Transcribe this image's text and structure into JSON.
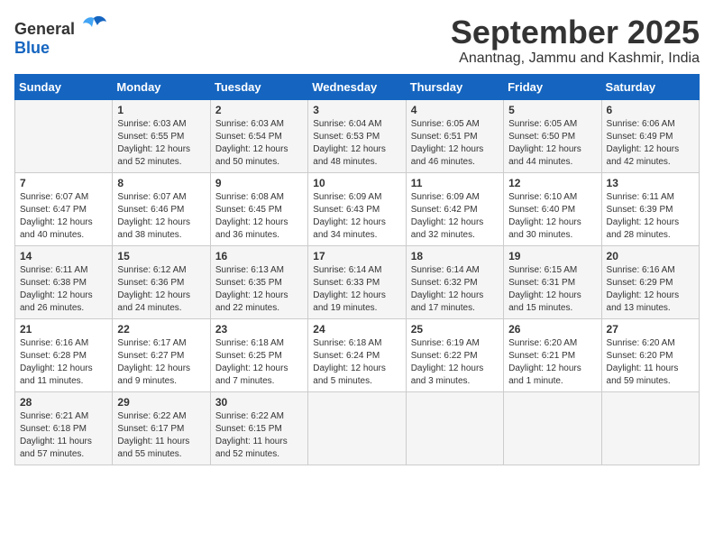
{
  "logo": {
    "general": "General",
    "blue": "Blue"
  },
  "header": {
    "month": "September 2025",
    "location": "Anantnag, Jammu and Kashmir, India"
  },
  "weekdays": [
    "Sunday",
    "Monday",
    "Tuesday",
    "Wednesday",
    "Thursday",
    "Friday",
    "Saturday"
  ],
  "weeks": [
    [
      {
        "day": "",
        "content": ""
      },
      {
        "day": "1",
        "content": "Sunrise: 6:03 AM\nSunset: 6:55 PM\nDaylight: 12 hours\nand 52 minutes."
      },
      {
        "day": "2",
        "content": "Sunrise: 6:03 AM\nSunset: 6:54 PM\nDaylight: 12 hours\nand 50 minutes."
      },
      {
        "day": "3",
        "content": "Sunrise: 6:04 AM\nSunset: 6:53 PM\nDaylight: 12 hours\nand 48 minutes."
      },
      {
        "day": "4",
        "content": "Sunrise: 6:05 AM\nSunset: 6:51 PM\nDaylight: 12 hours\nand 46 minutes."
      },
      {
        "day": "5",
        "content": "Sunrise: 6:05 AM\nSunset: 6:50 PM\nDaylight: 12 hours\nand 44 minutes."
      },
      {
        "day": "6",
        "content": "Sunrise: 6:06 AM\nSunset: 6:49 PM\nDaylight: 12 hours\nand 42 minutes."
      }
    ],
    [
      {
        "day": "7",
        "content": "Sunrise: 6:07 AM\nSunset: 6:47 PM\nDaylight: 12 hours\nand 40 minutes."
      },
      {
        "day": "8",
        "content": "Sunrise: 6:07 AM\nSunset: 6:46 PM\nDaylight: 12 hours\nand 38 minutes."
      },
      {
        "day": "9",
        "content": "Sunrise: 6:08 AM\nSunset: 6:45 PM\nDaylight: 12 hours\nand 36 minutes."
      },
      {
        "day": "10",
        "content": "Sunrise: 6:09 AM\nSunset: 6:43 PM\nDaylight: 12 hours\nand 34 minutes."
      },
      {
        "day": "11",
        "content": "Sunrise: 6:09 AM\nSunset: 6:42 PM\nDaylight: 12 hours\nand 32 minutes."
      },
      {
        "day": "12",
        "content": "Sunrise: 6:10 AM\nSunset: 6:40 PM\nDaylight: 12 hours\nand 30 minutes."
      },
      {
        "day": "13",
        "content": "Sunrise: 6:11 AM\nSunset: 6:39 PM\nDaylight: 12 hours\nand 28 minutes."
      }
    ],
    [
      {
        "day": "14",
        "content": "Sunrise: 6:11 AM\nSunset: 6:38 PM\nDaylight: 12 hours\nand 26 minutes."
      },
      {
        "day": "15",
        "content": "Sunrise: 6:12 AM\nSunset: 6:36 PM\nDaylight: 12 hours\nand 24 minutes."
      },
      {
        "day": "16",
        "content": "Sunrise: 6:13 AM\nSunset: 6:35 PM\nDaylight: 12 hours\nand 22 minutes."
      },
      {
        "day": "17",
        "content": "Sunrise: 6:14 AM\nSunset: 6:33 PM\nDaylight: 12 hours\nand 19 minutes."
      },
      {
        "day": "18",
        "content": "Sunrise: 6:14 AM\nSunset: 6:32 PM\nDaylight: 12 hours\nand 17 minutes."
      },
      {
        "day": "19",
        "content": "Sunrise: 6:15 AM\nSunset: 6:31 PM\nDaylight: 12 hours\nand 15 minutes."
      },
      {
        "day": "20",
        "content": "Sunrise: 6:16 AM\nSunset: 6:29 PM\nDaylight: 12 hours\nand 13 minutes."
      }
    ],
    [
      {
        "day": "21",
        "content": "Sunrise: 6:16 AM\nSunset: 6:28 PM\nDaylight: 12 hours\nand 11 minutes."
      },
      {
        "day": "22",
        "content": "Sunrise: 6:17 AM\nSunset: 6:27 PM\nDaylight: 12 hours\nand 9 minutes."
      },
      {
        "day": "23",
        "content": "Sunrise: 6:18 AM\nSunset: 6:25 PM\nDaylight: 12 hours\nand 7 minutes."
      },
      {
        "day": "24",
        "content": "Sunrise: 6:18 AM\nSunset: 6:24 PM\nDaylight: 12 hours\nand 5 minutes."
      },
      {
        "day": "25",
        "content": "Sunrise: 6:19 AM\nSunset: 6:22 PM\nDaylight: 12 hours\nand 3 minutes."
      },
      {
        "day": "26",
        "content": "Sunrise: 6:20 AM\nSunset: 6:21 PM\nDaylight: 12 hours\nand 1 minute."
      },
      {
        "day": "27",
        "content": "Sunrise: 6:20 AM\nSunset: 6:20 PM\nDaylight: 11 hours\nand 59 minutes."
      }
    ],
    [
      {
        "day": "28",
        "content": "Sunrise: 6:21 AM\nSunset: 6:18 PM\nDaylight: 11 hours\nand 57 minutes."
      },
      {
        "day": "29",
        "content": "Sunrise: 6:22 AM\nSunset: 6:17 PM\nDaylight: 11 hours\nand 55 minutes."
      },
      {
        "day": "30",
        "content": "Sunrise: 6:22 AM\nSunset: 6:15 PM\nDaylight: 11 hours\nand 52 minutes."
      },
      {
        "day": "",
        "content": ""
      },
      {
        "day": "",
        "content": ""
      },
      {
        "day": "",
        "content": ""
      },
      {
        "day": "",
        "content": ""
      }
    ]
  ]
}
